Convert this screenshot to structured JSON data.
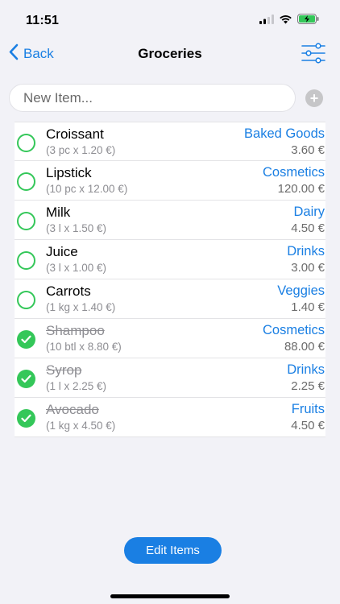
{
  "status_bar": {
    "time": "11:51",
    "icons": [
      "signal-icon",
      "wifi-icon",
      "battery-charging-icon"
    ]
  },
  "navbar": {
    "back_label": "Back",
    "title": "Groceries",
    "filter_icon": "sliders-icon"
  },
  "new_item": {
    "placeholder": "New Item...",
    "add_icon": "plus-icon"
  },
  "items": [
    {
      "name": "Croissant",
      "detail": "(3 pc x 1.20 €)",
      "category": "Baked Goods",
      "price": "3.60 €",
      "checked": false
    },
    {
      "name": "Lipstick",
      "detail": "(10 pc x 12.00 €)",
      "category": "Cosmetics",
      "price": "120.00 €",
      "checked": false
    },
    {
      "name": "Milk",
      "detail": "(3 l x 1.50 €)",
      "category": "Dairy",
      "price": "4.50 €",
      "checked": false
    },
    {
      "name": "Juice",
      "detail": "(3 l x 1.00 €)",
      "category": "Drinks",
      "price": "3.00 €",
      "checked": false
    },
    {
      "name": "Carrots",
      "detail": "(1 kg x 1.40 €)",
      "category": "Veggies",
      "price": "1.40 €",
      "checked": false
    },
    {
      "name": "Shampoo",
      "detail": "(10 btl x 8.80 €)",
      "category": "Cosmetics",
      "price": "88.00 €",
      "checked": true
    },
    {
      "name": "Syrop",
      "detail": "(1 l x 2.25 €)",
      "category": "Drinks",
      "price": "2.25 €",
      "checked": true
    },
    {
      "name": "Avocado",
      "detail": "(1 kg x 4.50 €)",
      "category": "Fruits",
      "price": "4.50 €",
      "checked": true
    }
  ],
  "edit_button_label": "Edit Items",
  "colors": {
    "accent": "#1a7fe3",
    "check_green": "#34c759",
    "background": "#f2f2f7"
  }
}
